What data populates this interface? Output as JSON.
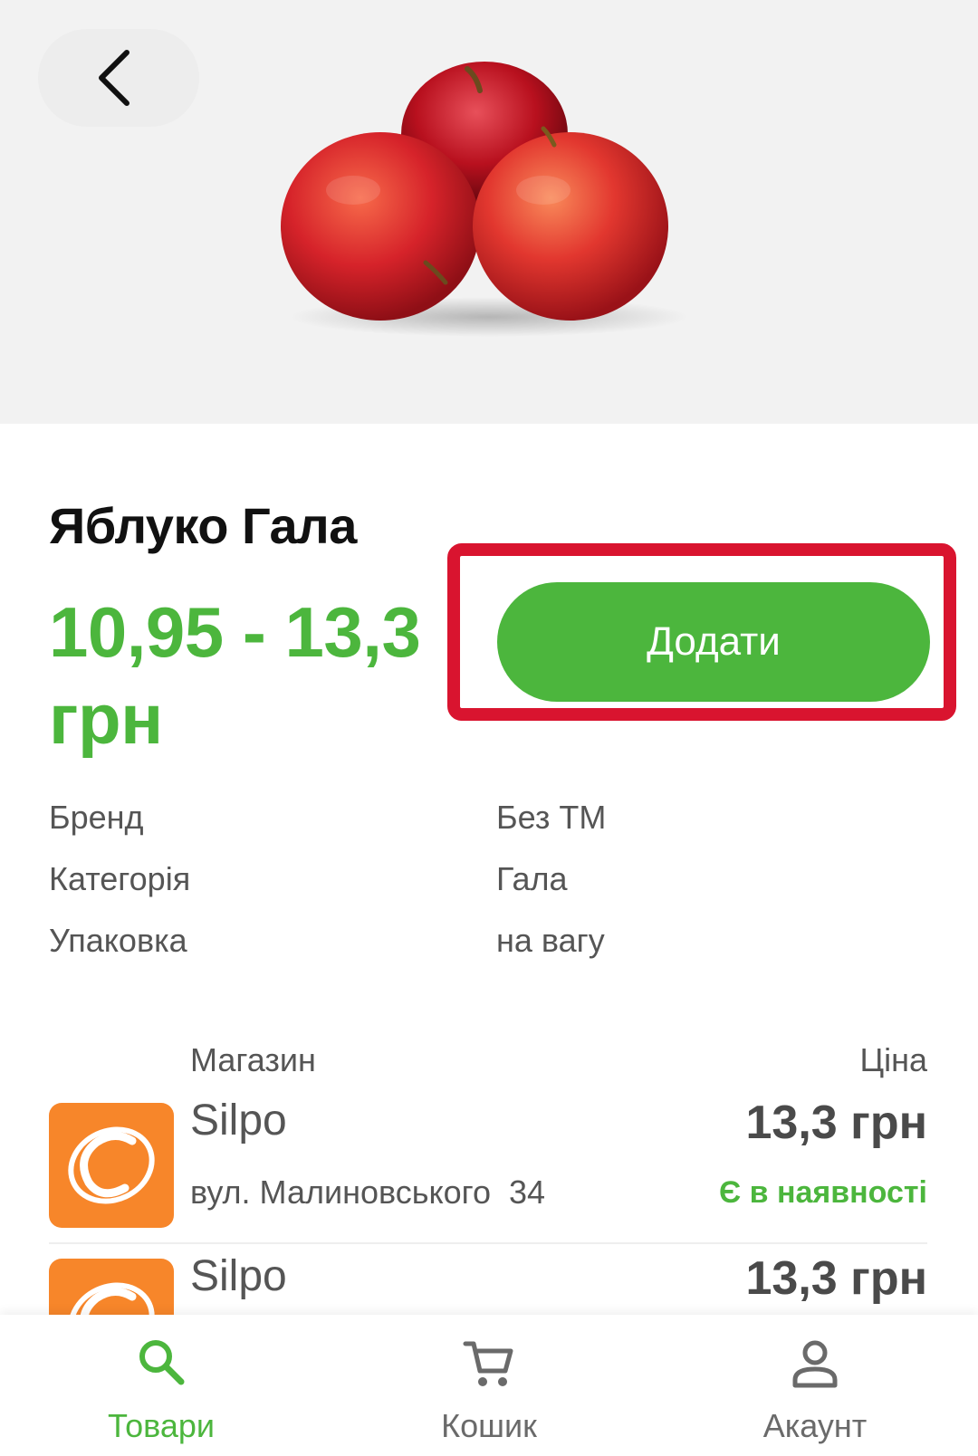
{
  "product": {
    "title": "Яблуко Гала",
    "price_range": "10,95 - 13,3 грн",
    "add_label": "Додати",
    "attributes": [
      {
        "key": "Бренд",
        "value": "Без ТМ"
      },
      {
        "key": "Категорія",
        "value": "Гала"
      },
      {
        "key": "Упаковка",
        "value": "на вагу"
      }
    ]
  },
  "stores": {
    "header_shop": "Магазин",
    "header_price": "Ціна",
    "rows": [
      {
        "name": "Silpo",
        "address": "вул. Малиновського  34",
        "price": "13,3 грн",
        "status": "Є в наявності"
      },
      {
        "name": "Silpo",
        "price": "13,3 грн"
      }
    ]
  },
  "nav": {
    "items": [
      {
        "label": "Товари",
        "icon": "search-icon",
        "active": true
      },
      {
        "label": "Кошик",
        "icon": "cart-icon",
        "active": false
      },
      {
        "label": "Акаунт",
        "icon": "account-icon",
        "active": false
      }
    ]
  },
  "colors": {
    "accent": "#4cb63d",
    "highlight": "#d9142f",
    "store_logo": "#f7862a"
  }
}
